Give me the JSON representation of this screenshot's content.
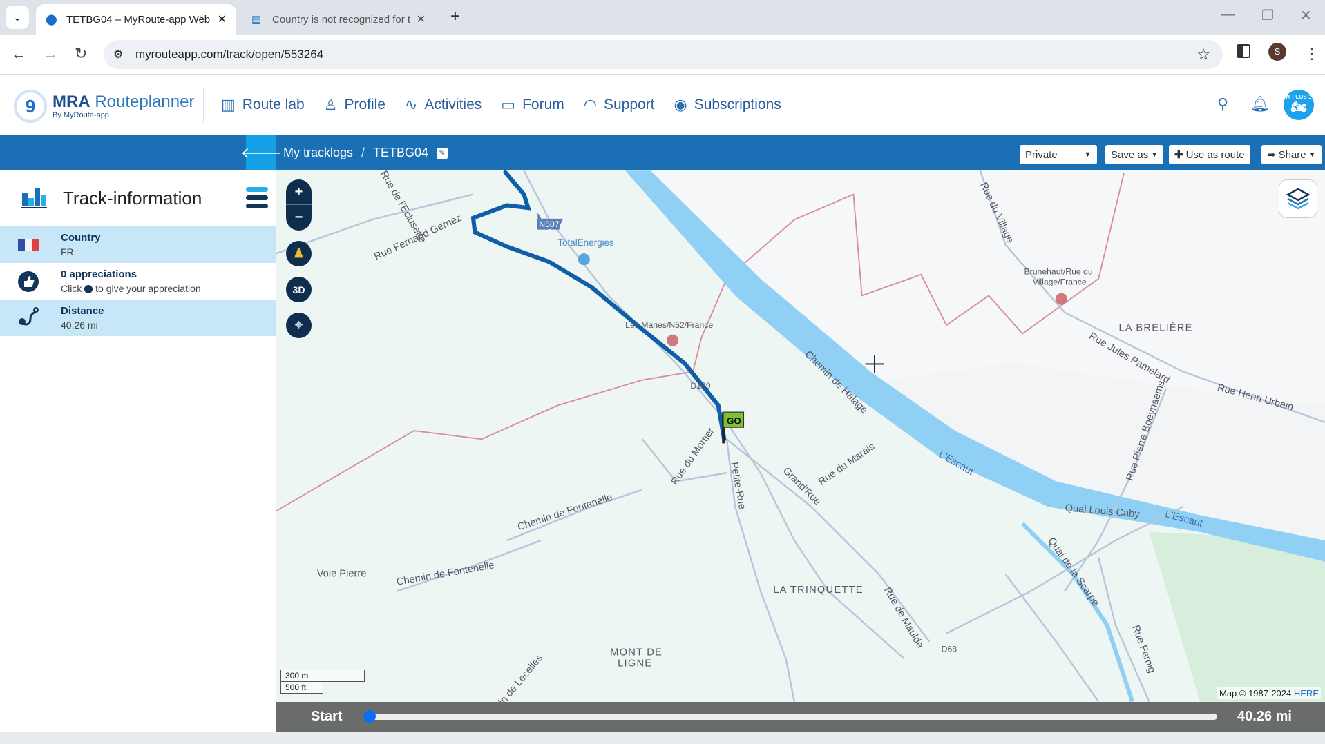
{
  "browser": {
    "tabs": [
      {
        "title": "TETBG04 – MyRoute-app Web",
        "active": true
      },
      {
        "title": "Country is not recognized for tr",
        "active": false
      }
    ],
    "url": "myrouteapp.com/track/open/553264",
    "profile_initial": "S"
  },
  "app": {
    "logo": {
      "name": "MRA",
      "name2": " Routeplanner",
      "tagline": "By MyRoute-app"
    },
    "menu": [
      {
        "label": "Route lab",
        "icon": "book-icon"
      },
      {
        "label": "Profile",
        "icon": "user-icon"
      },
      {
        "label": "Activities",
        "icon": "pulse-icon"
      },
      {
        "label": "Forum",
        "icon": "chat-icon"
      },
      {
        "label": "Support",
        "icon": "headset-icon"
      },
      {
        "label": "Subscriptions",
        "icon": "rocket-icon"
      }
    ],
    "avatar_text": "M PLUS 1"
  },
  "toolbar": {
    "breadcrumb": [
      "My tracklogs",
      "/",
      "TETBG04"
    ],
    "visibility": "Private",
    "save_as": "Save as",
    "use_as_route": "Use as route",
    "share": "Share"
  },
  "sidebar": {
    "title": "Track-information",
    "rows": [
      {
        "label": "Country",
        "value": "FR",
        "icon": "france-flag-icon"
      },
      {
        "label": "0 appreciations",
        "value_pre": "Click",
        "value_post": "to give your appreciation",
        "icon": "thumbs-up-icon"
      },
      {
        "label": "Distance",
        "value": "40.26 mi",
        "icon": "route-icon"
      }
    ]
  },
  "map": {
    "controls": {
      "zoom_in": "+",
      "zoom_out": "−",
      "three_d": "3D"
    },
    "labels": [
      "Rue de l'Eclusette",
      "Rue Fernand Gernez",
      "N507",
      "TotalEnergies",
      "Les Maries/N52/France",
      "D169",
      "Chemin de Halage",
      "Brunehaut/Rue du",
      "Village/France",
      "LA BRELIÈRE",
      "Rue du Village",
      "Rue Jules Pamelard",
      "Rue Henri Urbain",
      "Rue Pierre Boeynaems",
      "L'Escaut",
      "Quai Louis Caby",
      "L'Escaut",
      "Rue du Mortier",
      "Petite-Rue",
      "Grand'Rue",
      "Rue du Marais",
      "Chemin de Fontenelle",
      "Voie Pierre",
      "Chemin de Fontenelle",
      "LA TRINQUETTE",
      "Rue de Maulde",
      "D68",
      "Quai de la Scarpe",
      "MONT DE",
      "LIGNE",
      "Chemin de Lecelles",
      "Rue Fernig",
      "GO"
    ],
    "scale": [
      "300 m",
      "500 ft"
    ],
    "attribution": "Map © 1987-2024",
    "attribution_link": "HERE",
    "colors": {
      "river": "#90d0f5",
      "track": "#0f5fa8",
      "border": "#d98aa0",
      "land": "#eef6f4"
    }
  },
  "player": {
    "start": "Start",
    "end": "40.26 mi",
    "progress": 0
  }
}
